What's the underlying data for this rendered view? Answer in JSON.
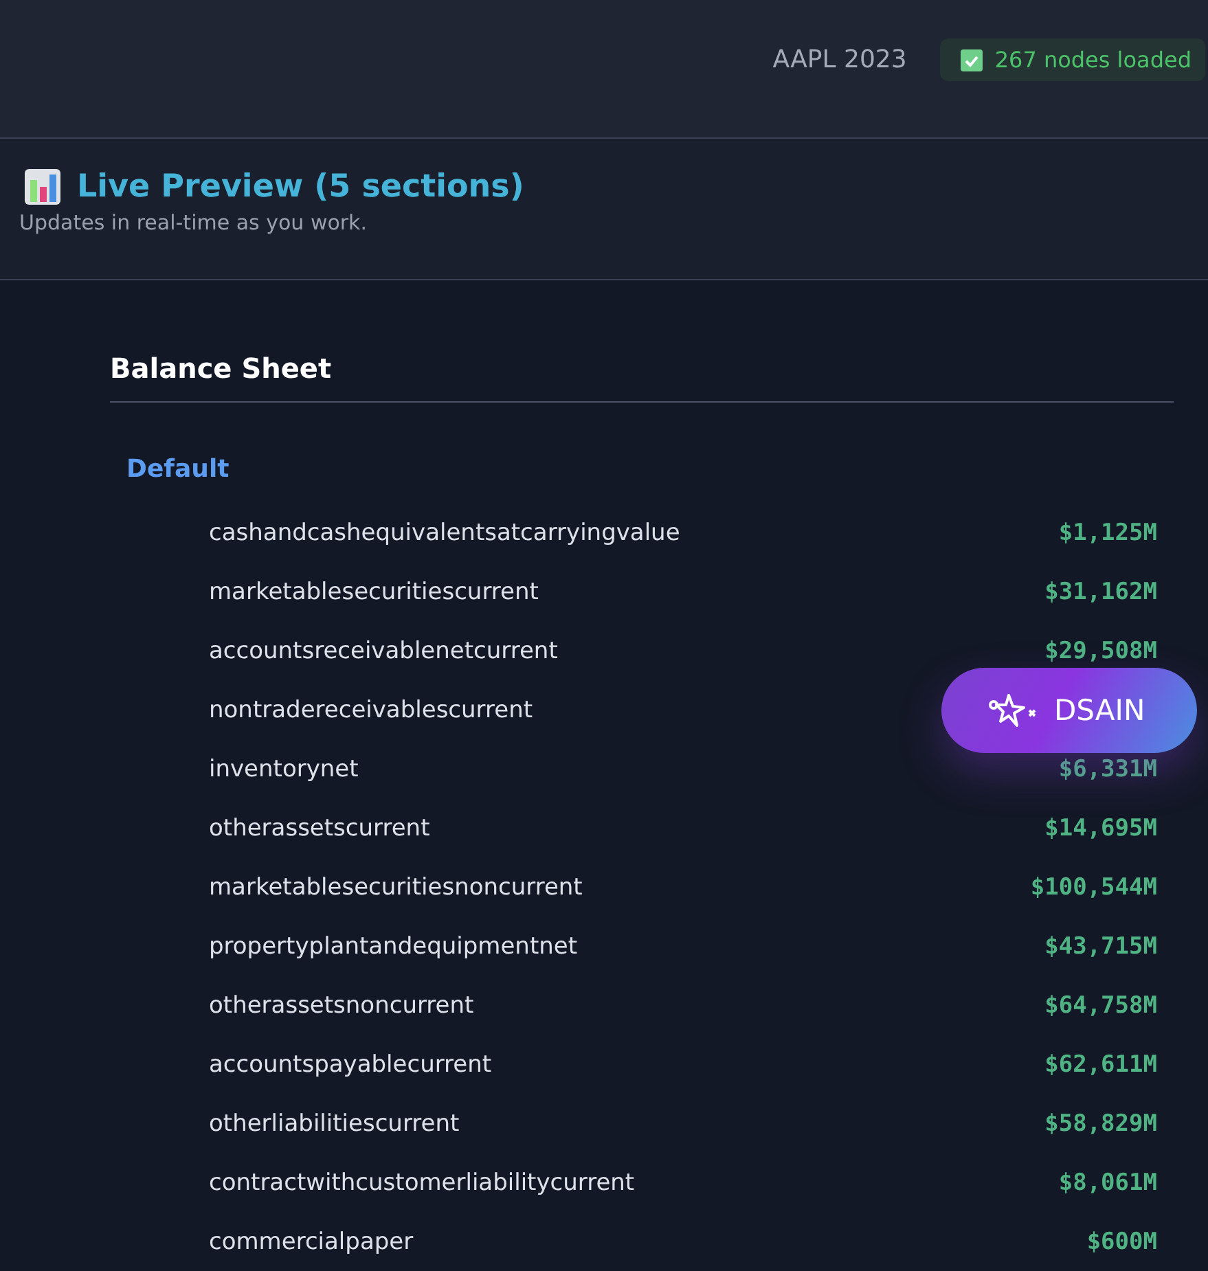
{
  "header": {
    "ticker": "AAPL 2023",
    "status": "267 nodes loaded"
  },
  "preview": {
    "title": "Live Preview (5 sections)",
    "subtitle": "Updates in real-time as you work."
  },
  "section": {
    "title": "Balance Sheet",
    "group": "Default",
    "rows": [
      {
        "label": "cashandcashequivalentsatcarryingvalue",
        "value": "$1,125M"
      },
      {
        "label": "marketablesecuritiescurrent",
        "value": "$31,162M"
      },
      {
        "label": "accountsreceivablenetcurrent",
        "value": "$29,508M"
      },
      {
        "label": "nontradereceivablescurrent"
      },
      {
        "label": "inventorynet",
        "value": "$6,331M"
      },
      {
        "label": "otherassetscurrent",
        "value": "$14,695M"
      },
      {
        "label": "marketablesecuritiesnoncurrent",
        "value": "$100,544M"
      },
      {
        "label": "propertyplantandequipmentnet",
        "value": "$43,715M"
      },
      {
        "label": "otherassetsnoncurrent",
        "value": "$64,758M"
      },
      {
        "label": "accountspayablecurrent",
        "value": "$62,611M"
      },
      {
        "label": "otherliabilitiescurrent",
        "value": "$58,829M"
      },
      {
        "label": "contractwithcustomerliabilitycurrent",
        "value": "$8,061M"
      },
      {
        "label": "commercialpaper",
        "value": "$600M"
      }
    ]
  },
  "floating_button": {
    "label": "DSAIN"
  }
}
